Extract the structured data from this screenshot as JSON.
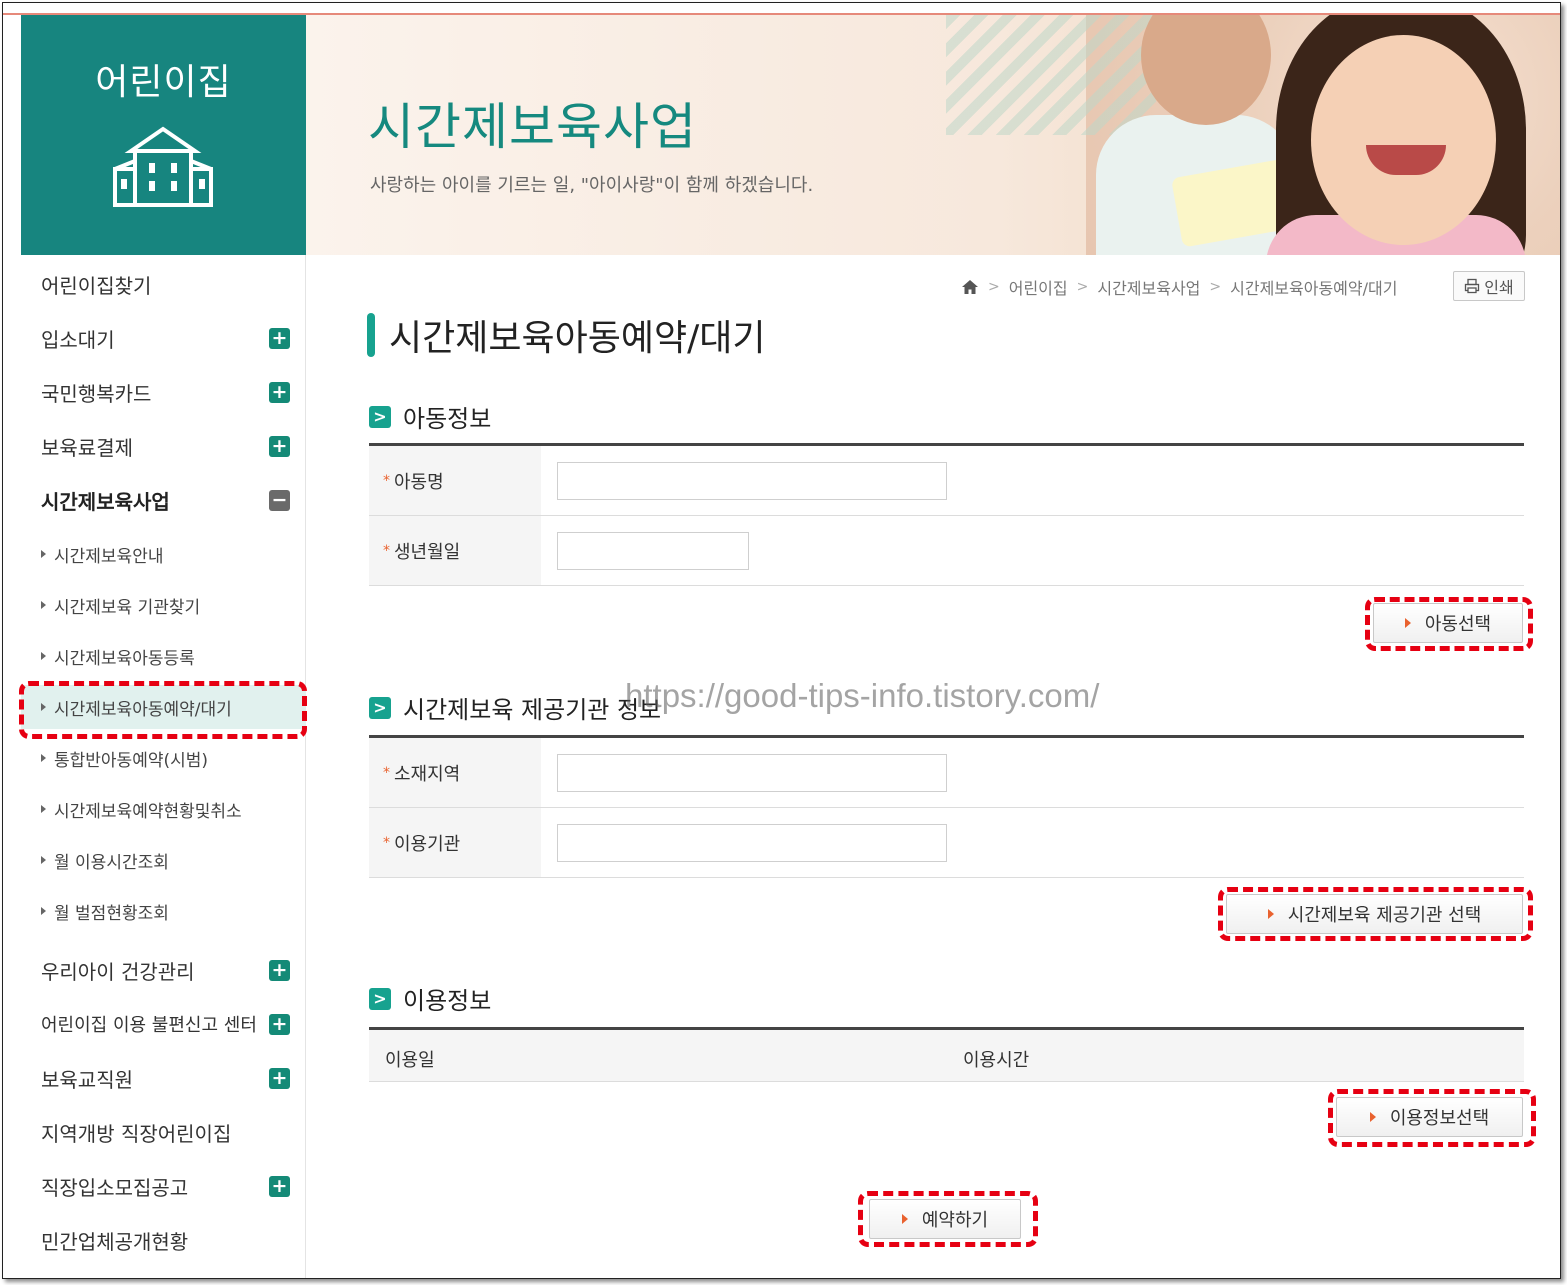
{
  "sidebar": {
    "title": "어린이집",
    "building_icon": "building-icon",
    "menu": [
      {
        "label": "어린이집찾기",
        "expand": ""
      },
      {
        "label": "입소대기",
        "expand": "+"
      },
      {
        "label": "국민행복카드",
        "expand": "+"
      },
      {
        "label": "보육료결제",
        "expand": "+"
      },
      {
        "label": "시간제보육사업",
        "expand": "−"
      }
    ],
    "submenu": [
      {
        "label": "시간제보육안내"
      },
      {
        "label": "시간제보육 기관찾기"
      },
      {
        "label": "시간제보육아동등록"
      },
      {
        "label": "시간제보육아동예약/대기"
      },
      {
        "label": "통합반아동예약(시범)"
      },
      {
        "label": "시간제보육예약현황및취소"
      },
      {
        "label": "월 이용시간조회"
      },
      {
        "label": "월 벌점현황조회"
      }
    ],
    "menu2": [
      {
        "label": "우리아이 건강관리",
        "expand": "+"
      },
      {
        "label": "어린이집 이용 불편신고 센터",
        "expand": "+"
      },
      {
        "label": "보육교직원",
        "expand": "+"
      },
      {
        "label": "지역개방 직장어린이집",
        "expand": ""
      },
      {
        "label": "직장입소모집공고",
        "expand": "+"
      },
      {
        "label": "민간업체공개현황",
        "expand": ""
      }
    ]
  },
  "banner": {
    "title": "시간제보육사업",
    "subtitle": "사랑하는 아이를 기르는 일, \"아이사랑\"이 함께 하겠습니다."
  },
  "breadcrumb": {
    "home_icon": "home-icon",
    "items": [
      "어린이집",
      "시간제보육사업",
      "시간제보육아동예약/대기"
    ],
    "separator": ">"
  },
  "print_button": {
    "label": "인쇄",
    "icon": "print-icon"
  },
  "page_title": "시간제보육아동예약/대기",
  "sections": {
    "child": {
      "title": "아동정보",
      "fields": [
        {
          "label": "아동명",
          "value": ""
        },
        {
          "label": "생년월일",
          "value": ""
        }
      ],
      "button": "아동선택"
    },
    "provider": {
      "title": "시간제보육 제공기관 정보",
      "fields": [
        {
          "label": "소재지역",
          "value": ""
        },
        {
          "label": "이용기관",
          "value": ""
        }
      ],
      "button": "시간제보육 제공기관 선택"
    },
    "usage": {
      "title": "이용정보",
      "columns": [
        "이용일",
        "이용시간"
      ],
      "button": "이용정보선택"
    }
  },
  "reserve_button": "예약하기",
  "required_mark": "*",
  "watermark": "https://good-tips-info.tistory.com/",
  "colors": {
    "brand": "#17857f",
    "accent": "#17a28f",
    "highlight": "#e60012",
    "required": "#e9622f"
  }
}
